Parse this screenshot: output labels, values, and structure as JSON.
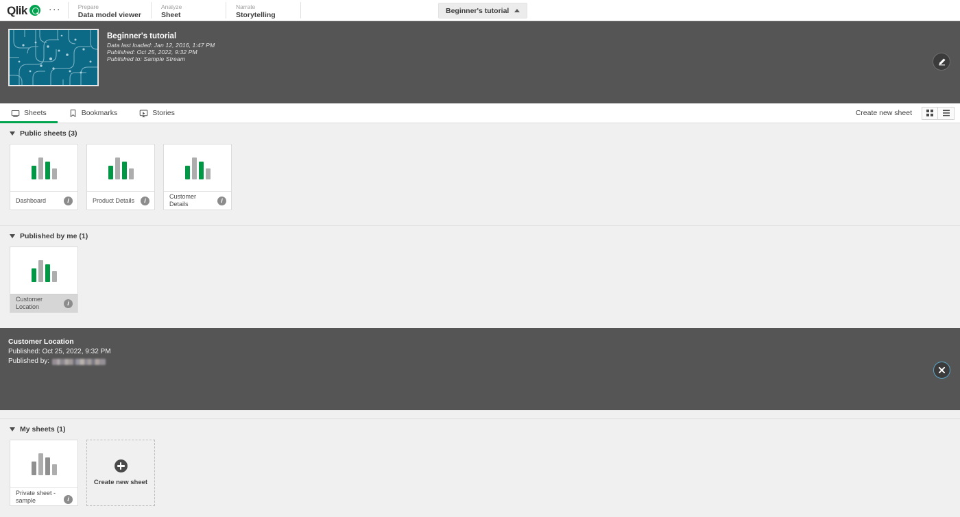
{
  "topbar": {
    "logo_text": "Qlik",
    "overflow_menu": "···",
    "nav": [
      {
        "kicker": "Prepare",
        "label": "Data model viewer"
      },
      {
        "kicker": "Analyze",
        "label": "Sheet"
      },
      {
        "kicker": "Narrate",
        "label": "Storytelling"
      }
    ],
    "app_switcher_label": "Beginner's tutorial"
  },
  "app_header": {
    "title": "Beginner's tutorial",
    "data_last_loaded": "Data last loaded: Jan 12, 2016, 1:47 PM",
    "published": "Published: Oct 25, 2022, 9:32 PM",
    "published_to": "Published to: Sample Stream",
    "thumb_bg_color": "#0d6a87",
    "thumb_line_color": "#7fb7c9"
  },
  "tabs": {
    "items": [
      {
        "label": "Sheets",
        "icon": "sheet-icon",
        "active": true
      },
      {
        "label": "Bookmarks",
        "icon": "bookmark-icon",
        "active": false
      },
      {
        "label": "Stories",
        "icon": "story-icon",
        "active": false
      }
    ],
    "create_new_sheet": "Create new sheet",
    "active_underline_color": "#00a44f"
  },
  "sections": [
    {
      "heading": "Public sheets (3)",
      "cards": [
        {
          "name": "Dashboard",
          "bars": [
            "green",
            "gray",
            "green",
            "gray"
          ],
          "selected": false
        },
        {
          "name": "Product Details",
          "bars": [
            "green",
            "gray",
            "green",
            "gray"
          ],
          "selected": false
        },
        {
          "name": "Customer Details",
          "bars": [
            "green",
            "gray",
            "green",
            "gray"
          ],
          "selected": false
        }
      ]
    },
    {
      "heading": "Published by me (1)",
      "cards": [
        {
          "name": "Customer Location",
          "bars": [
            "green",
            "gray",
            "green",
            "gray"
          ],
          "selected": true
        }
      ]
    },
    {
      "heading": "My sheets (1)",
      "cards": [
        {
          "name": "Private sheet - sample",
          "bars": [
            "gray",
            "gray",
            "gray",
            "gray"
          ],
          "selected": false
        }
      ],
      "create_card_label": "Create new\nsheet"
    }
  ],
  "detail_panel": {
    "title": "Customer Location",
    "published_label": "Published: Oct 25, 2022, 9:32 PM",
    "published_by_label": "Published by:",
    "published_by_value_redacted": true
  },
  "colors": {
    "accent_green": "#00a44f",
    "dark_panel": "#555555",
    "page_bg": "#f0f0f0",
    "bar_green": "#009845",
    "bar_gray": "#adadad"
  }
}
